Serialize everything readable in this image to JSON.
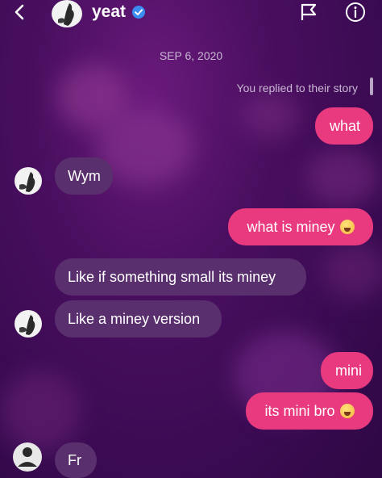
{
  "header": {
    "title": "yeat",
    "colors": {
      "accent": "#e9397f",
      "incoming_bubble": "#5a2f6e",
      "verified": "#3b8cf0"
    }
  },
  "conversation": {
    "date": "SEP 6, 2020",
    "story_reply_note": "You replied to their story",
    "messages": [
      {
        "id": "m1",
        "sender": "me",
        "text": "what"
      },
      {
        "id": "m2",
        "sender": "them",
        "text": "Wym"
      },
      {
        "id": "m3",
        "sender": "me",
        "text": "what is miney",
        "emoji": "loudly-crying-face"
      },
      {
        "id": "m4",
        "sender": "them",
        "text": "Like if something small its miney"
      },
      {
        "id": "m5",
        "sender": "them",
        "text": "Like a miney version"
      },
      {
        "id": "m6",
        "sender": "me",
        "text": "mini"
      },
      {
        "id": "m7",
        "sender": "me",
        "text": "its mini bro",
        "emoji": "loudly-crying-face"
      },
      {
        "id": "m8",
        "sender": "them",
        "text": "Fr"
      }
    ]
  }
}
